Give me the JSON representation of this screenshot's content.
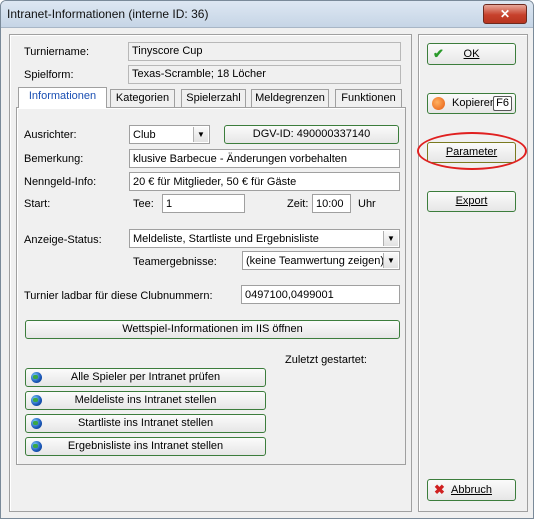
{
  "window": {
    "title": "Intranet-Informationen (interne ID: 36)"
  },
  "header": {
    "turniername_label": "Turniername:",
    "turniername_value": "Tinyscore Cup",
    "spielform_label": "Spielform:",
    "spielform_value": "Texas-Scramble; 18 Löcher"
  },
  "tabs": [
    "Informationen",
    "Kategorien",
    "Spielerzahl",
    "Meldegrenzen",
    "Funktionen"
  ],
  "form": {
    "ausrichter_label": "Ausrichter:",
    "ausrichter_value": "Club",
    "dgv_button": "DGV-ID: 490000337140",
    "bemerkung_label": "Bemerkung:",
    "bemerkung_value": "klusive Barbecue - Änderungen vorbehalten",
    "nenngeld_label": "Nenngeld-Info:",
    "nenngeld_value": "20 € für Mitglieder, 50 € für Gäste",
    "start_label": "Start:",
    "tee_label": "Tee:",
    "tee_value": "1",
    "zeit_label": "Zeit:",
    "zeit_value": "10:00",
    "uhr_label": "Uhr",
    "anzeige_label": "Anzeige-Status:",
    "anzeige_value": "Meldeliste, Startliste und Ergebnisliste",
    "team_label": "Teamergebnisse:",
    "team_value": "(keine Teamwertung zeigen)",
    "ladbar_label": "Turnier ladbar für diese Clubnummern:",
    "ladbar_value": "0497100,0499001",
    "iis_button": "Wettspiel-Informationen im IIS öffnen",
    "zuletzt_label": "Zuletzt gestartet:",
    "intranet_buttons": [
      "Alle Spieler per Intranet prüfen",
      "Meldeliste ins Intranet stellen",
      "Startliste ins Intranet stellen",
      "Ergebnisliste ins Intranet stellen"
    ]
  },
  "side": {
    "ok": "OK",
    "kopieren": "Kopieren",
    "kopieren_key": "F6",
    "parameter": "Parameter",
    "export": "Export",
    "abbruch": "Abbruch"
  },
  "colors": {
    "highlight_ellipse": "#e02020",
    "button_border": "#3c7d3c",
    "active_tab_text": "#1a4fb3"
  }
}
